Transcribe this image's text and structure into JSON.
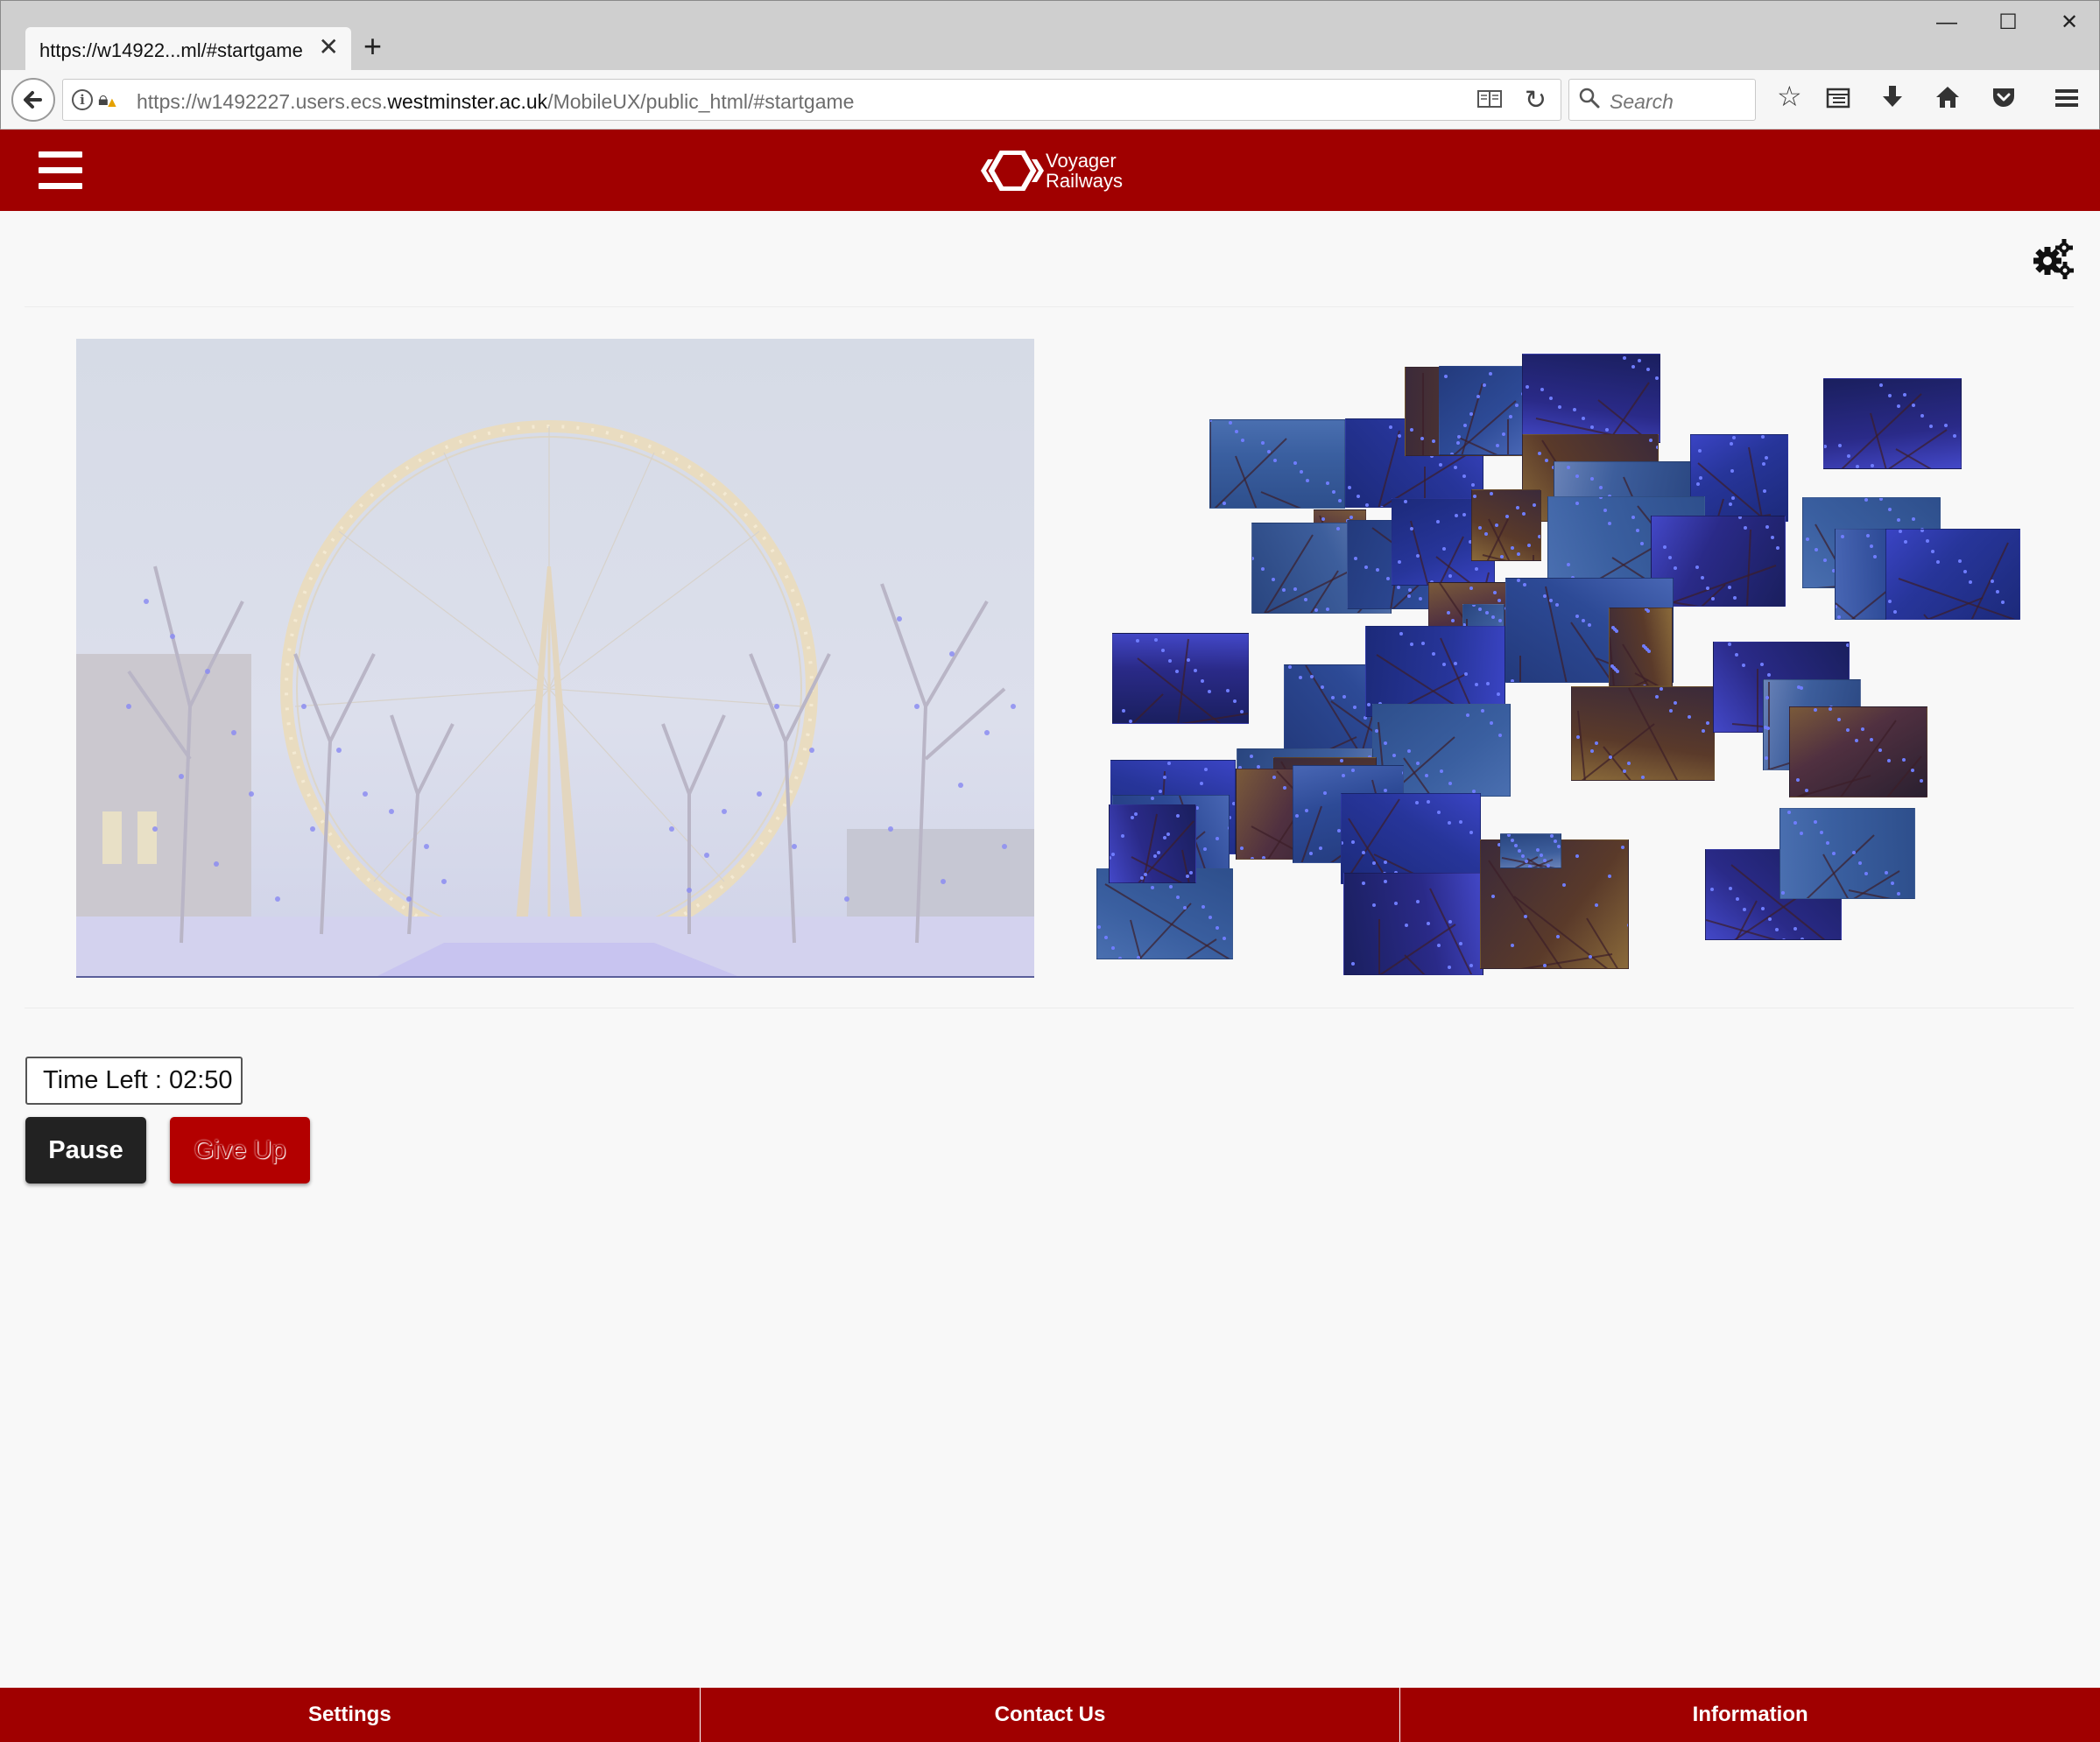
{
  "browser": {
    "tab_title": "https://w14922...ml/#startgame",
    "new_tab": "+",
    "url_prefix": "https://w1492227.users.ecs.",
    "url_domain": "westminster.ac.uk",
    "url_suffix": "/MobileUX/public_html/#startgame",
    "search_placeholder": "Search",
    "window_controls": {
      "minimize": "—",
      "maximize": "☐",
      "close": "✕"
    }
  },
  "header": {
    "brand_line1": "Voyager",
    "brand_line2": "Railways"
  },
  "game": {
    "timer_text": "Time Left : 02:50",
    "pause_label": "Pause",
    "giveup_label": "Give Up"
  },
  "footer": {
    "items": [
      "Settings",
      "Contact Us",
      "Information"
    ]
  },
  "colors": {
    "brand_red": "#a00000",
    "page_bg": "#f8f8f8",
    "pause_bg": "#222222",
    "giveup_bg": "#b30000"
  },
  "icons": [
    "back-arrow-icon",
    "info-icon",
    "lock-warning-icon",
    "reader-view-icon",
    "reload-icon",
    "search-icon",
    "bookmark-star-icon",
    "library-icon",
    "download-icon",
    "home-icon",
    "pocket-icon",
    "menu-icon",
    "hamburger-icon",
    "settings-gears-icon",
    "tab-close-icon"
  ]
}
